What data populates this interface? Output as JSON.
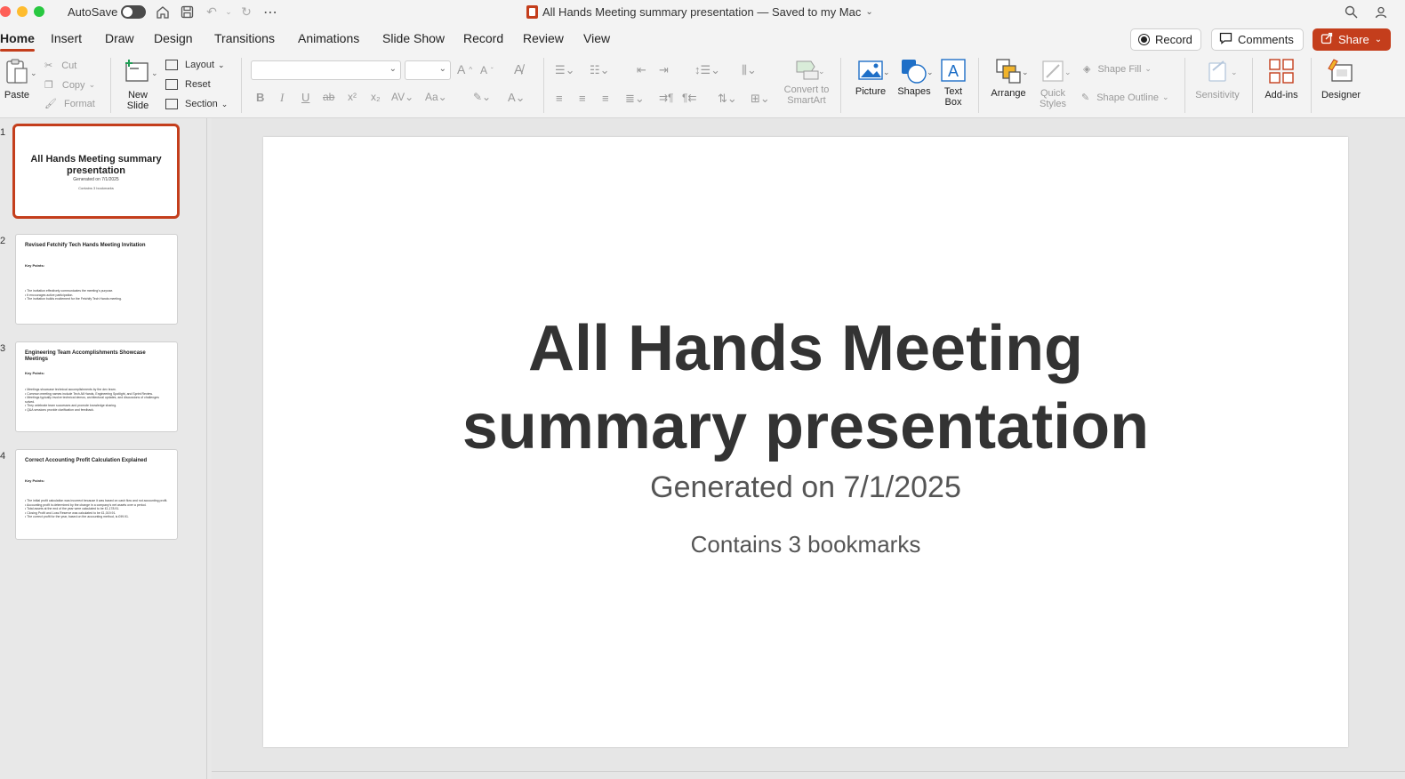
{
  "window": {
    "title": "All Hands Meeting summary presentation — Saved to my Mac",
    "autosave_label": "AutoSave",
    "traffic_colors": [
      "#fe5f57",
      "#febc2e",
      "#28c840"
    ]
  },
  "tabs": [
    "Home",
    "Insert",
    "Draw",
    "Design",
    "Transitions",
    "Animations",
    "Slide Show",
    "Record",
    "Review",
    "View"
  ],
  "actions": {
    "record": "Record",
    "comments": "Comments",
    "share": "Share"
  },
  "ribbon": {
    "paste": "Paste",
    "cut": "Cut",
    "copy": "Copy",
    "format": "Format",
    "new_slide_1": "New",
    "new_slide_2": "Slide",
    "layout": "Layout",
    "reset": "Reset",
    "section": "Section",
    "convert_1": "Convert to",
    "convert_2": "SmartArt",
    "picture": "Picture",
    "shapes": "Shapes",
    "textbox_1": "Text",
    "textbox_2": "Box",
    "arrange": "Arrange",
    "quick_styles_1": "Quick",
    "quick_styles_2": "Styles",
    "shape_fill": "Shape Fill",
    "shape_outline": "Shape Outline",
    "sensitivity": "Sensitivity",
    "addins": "Add-ins",
    "designer": "Designer",
    "font_name": "",
    "font_size": ""
  },
  "thumbnails": [
    {
      "number": "1",
      "title": "All Hands Meeting summary presentation",
      "subtitle": "Generated on 7/1/2025",
      "subtitle2": "Contains 3 bookmarks"
    },
    {
      "number": "2",
      "title": "Revised Fetchify Tech Hands Meeting Invitation",
      "key_points": "Key Points:",
      "bullets": [
        "• The invitation effectively communicates the meeting's purpose.",
        "• It encourages active participation.",
        "• The invitation builds excitement for the Fetchify Tech Hands meeting."
      ]
    },
    {
      "number": "3",
      "title": "Engineering Team Accomplishments Showcase Meetings",
      "key_points": "Key Points:",
      "bullets": [
        "• Meetings showcase technical accomplishments by the dev team.",
        "• Common meeting names include Tech All Hands, Engineering Spotlight, and Sprint Review.",
        "• Meetings typically involve technical demos, architectural updates, and discussions of challenges solved.",
        "• They celebrate team successes and promote knowledge sharing.",
        "• Q&A sessions provide clarification and feedback."
      ]
    },
    {
      "number": "4",
      "title": "Correct Accounting Profit Calculation Explained",
      "key_points": "Key Points:",
      "bullets": [
        "• The initial profit calculation was incorrect because it was based on cash flow and not accounting profit.",
        "• Accounting profit is determined by the change in a company's net assets over a period.",
        "• Total assets at the end of the year were calculated to be £1,178.91.",
        "• Closing Profit and Loss Reserve was calculated to be £1,019.91.",
        "• The correct profit for the year, based on the accounting method, is £99.91."
      ]
    }
  ],
  "slide": {
    "title_line1": "All Hands Meeting",
    "title_line2": "summary presentation",
    "subtitle": "Generated on 7/1/2025",
    "subtitle2": "Contains 3 bookmarks"
  },
  "colors": {
    "accent": "#c43e1c",
    "ribbon_bg": "#f3f3f3",
    "pane_bg": "#e8e8e8"
  }
}
